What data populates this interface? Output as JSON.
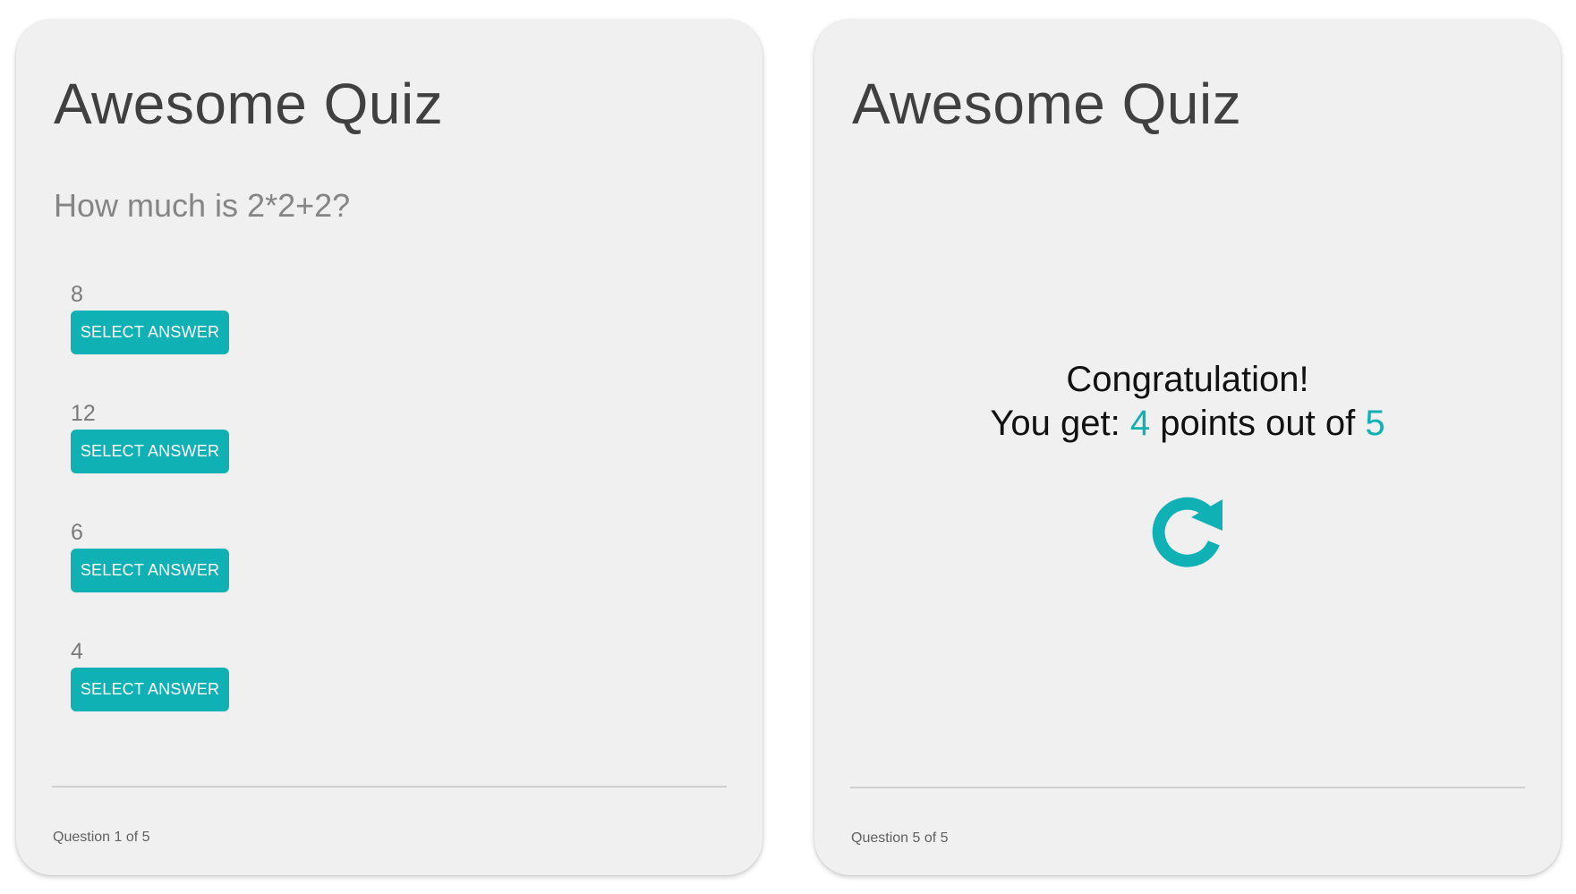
{
  "colors": {
    "accent": "#0fb1b5",
    "card_background": "#f0f0f0"
  },
  "left_card": {
    "title": "Awesome Quiz",
    "question": "How much is 2*2+2?",
    "answers": [
      {
        "label": "8",
        "button": "SELECT ANSWER"
      },
      {
        "label": "12",
        "button": "SELECT ANSWER"
      },
      {
        "label": "6",
        "button": "SELECT ANSWER"
      },
      {
        "label": "4",
        "button": "SELECT ANSWER"
      }
    ],
    "progress": "Question 1 of 5"
  },
  "right_card": {
    "title": "Awesome Quiz",
    "result": {
      "heading": "Congratulation!",
      "prefix": "You get:",
      "score": "4",
      "middle": "points out of",
      "total": "5"
    },
    "restart_icon": "restart-icon",
    "progress": "Question 5 of 5"
  }
}
